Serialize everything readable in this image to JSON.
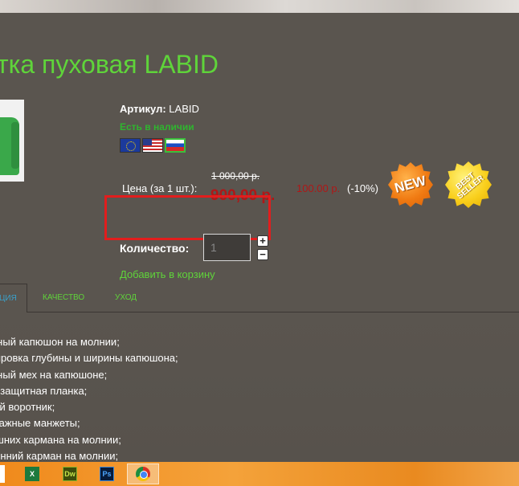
{
  "product": {
    "title": "тка пуховая LABID",
    "sku_label": "Артикул:",
    "sku_value": "LABID",
    "stock_status": "Есть в наличии",
    "flags": [
      {
        "name": "eu",
        "active": false
      },
      {
        "name": "us",
        "active": false
      },
      {
        "name": "ru",
        "active": true
      }
    ]
  },
  "pricing": {
    "label": "Цена (за 1 шт.):",
    "old_price": "1 000,00 р.",
    "new_price": "900,00 р.",
    "alt_price": "100.00 р.",
    "discount": "(-10%)"
  },
  "badges": {
    "new": "NEW",
    "best_seller": "BEST SELLER"
  },
  "cart": {
    "qty_label": "Количество:",
    "qty_value": "1",
    "plus": "+",
    "minus": "−",
    "add_to_cart": "Добавить в корзину"
  },
  "tabs": [
    {
      "label": "ЦИЯ",
      "active": true
    },
    {
      "label": "КАЧЕСТВО",
      "active": false
    },
    {
      "label": "УХОД",
      "active": false
    }
  ],
  "features": [
    "емный капюшон на молнии;",
    "улировка глубины и ширины капюшона;",
    "емный мех на капюшоне;",
    "трозащитная планка;",
    "ский воротник;",
    "котажные манжеты;",
    "нешних кармана на молнии;",
    "тренний карман на молнии;"
  ],
  "taskbar": {
    "apps": [
      {
        "name": "excel",
        "glyph": "X"
      },
      {
        "name": "dreamweaver",
        "glyph": "Dw"
      },
      {
        "name": "photoshop",
        "glyph": "Ps"
      },
      {
        "name": "chrome",
        "glyph": ""
      }
    ]
  },
  "colors": {
    "accent_green": "#5fd43a",
    "price_red": "#b01717",
    "highlight_red": "#e21d1d",
    "background": "#5a554f"
  }
}
